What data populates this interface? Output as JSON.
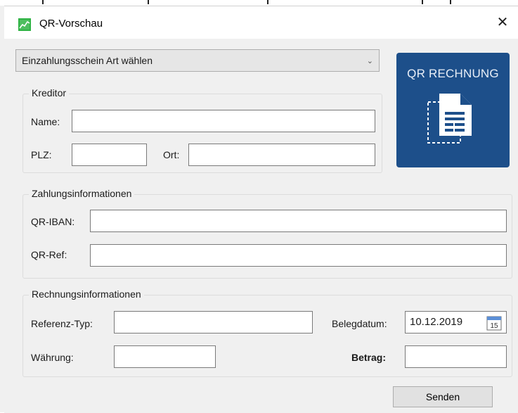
{
  "window": {
    "title": "QR-Vorschau",
    "close_symbol": "✕"
  },
  "select": {
    "value": "Einzahlungsschein Art wählen"
  },
  "logo": {
    "text": "QR RECHNUNG",
    "color": "#1d4f8a"
  },
  "kreditor": {
    "legend": "Kreditor",
    "name_label": "Name:",
    "name_value": "",
    "plz_label": "PLZ:",
    "plz_value": "",
    "ort_label": "Ort:",
    "ort_value": ""
  },
  "zahlung": {
    "legend": "Zahlungsinformationen",
    "iban_label": "QR-IBAN:",
    "iban_value": "",
    "ref_label": "QR-Ref:",
    "ref_value": ""
  },
  "rechnung": {
    "legend": "Rechnungsinformationen",
    "referenztyp_label": "Referenz-Typ:",
    "referenztyp_value": "",
    "belegdatum_label": "Belegdatum:",
    "belegdatum_value": "10.12.2019",
    "calendar_day": "15",
    "waehrung_label": "Währung:",
    "waehrung_value": "",
    "betrag_label": "Betrag:",
    "betrag_value": ""
  },
  "actions": {
    "send_label": "Senden"
  }
}
